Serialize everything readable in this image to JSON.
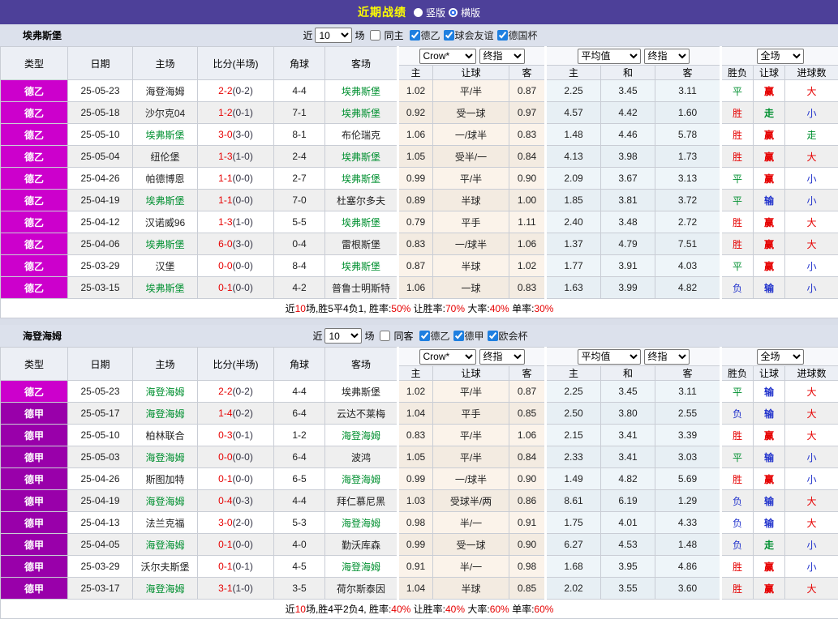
{
  "topbar": {
    "title": "近期战绩",
    "vertical": "竖版",
    "horizontal": "横版"
  },
  "colors": {
    "red": "#E60000",
    "green": "#009030",
    "blue": "#2233CC",
    "team": "#009030",
    "score": "#E60000",
    "half": "#333344",
    "topbar_bg": "#4D4099",
    "title_yellow": "#FFFF00"
  },
  "league_colors": {
    "德乙": "#CC00CC",
    "德甲": "#9900AA"
  },
  "result_colors": {
    "胜": "#E60000",
    "赢": "#E60000",
    "大": "#E60000",
    "平": "#009030",
    "走": "#009030",
    "负": "#2233CC",
    "输": "#2233CC",
    "小": "#2233CC"
  },
  "table_header": {
    "cols": [
      "类型",
      "日期",
      "主场",
      "比分(半场)",
      "角球",
      "客场"
    ],
    "bookmaker": "Crow*",
    "final1": "终指",
    "average": "平均值",
    "final2": "终指",
    "scope": "全场",
    "g1": [
      "主",
      "让球",
      "客"
    ],
    "g2": [
      "主",
      "和",
      "客"
    ],
    "g3": [
      "胜负",
      "让球",
      "进球数"
    ]
  },
  "sections": [
    {
      "team": "埃弗斯堡",
      "filter": {
        "near": "近",
        "count": "10",
        "suffix": "场",
        "same_label": "同主",
        "same_checked": false,
        "leagues": [
          {
            "label": "德乙",
            "checked": true
          },
          {
            "label": "球会友谊",
            "checked": true
          },
          {
            "label": "德国杯",
            "checked": true
          }
        ]
      },
      "rows": [
        {
          "lg": "德乙",
          "date": "25-05-23",
          "home": "海登海姆",
          "hs": false,
          "score": "2-2",
          "half": "(0-2)",
          "cor": "4-4",
          "away": "埃弗斯堡",
          "as": true,
          "o1": "1.02",
          "hc": "平/半",
          "o2": "0.87",
          "a1": "2.25",
          "a2": "3.45",
          "a3": "3.11",
          "r1": "平",
          "r2": "赢",
          "r3": "大"
        },
        {
          "lg": "德乙",
          "date": "25-05-18",
          "home": "沙尔克04",
          "hs": false,
          "score": "1-2",
          "half": "(0-1)",
          "cor": "7-1",
          "away": "埃弗斯堡",
          "as": true,
          "o1": "0.92",
          "hc": "受一球",
          "o2": "0.97",
          "a1": "4.57",
          "a2": "4.42",
          "a3": "1.60",
          "r1": "胜",
          "r2": "走",
          "r3": "小"
        },
        {
          "lg": "德乙",
          "date": "25-05-10",
          "home": "埃弗斯堡",
          "hs": true,
          "score": "3-0",
          "half": "(3-0)",
          "cor": "8-1",
          "away": "布伦瑞克",
          "as": false,
          "o1": "1.06",
          "hc": "一/球半",
          "o2": "0.83",
          "a1": "1.48",
          "a2": "4.46",
          "a3": "5.78",
          "r1": "胜",
          "r2": "赢",
          "r3": "走"
        },
        {
          "lg": "德乙",
          "date": "25-05-04",
          "home": "纽伦堡",
          "hs": false,
          "score": "1-3",
          "half": "(1-0)",
          "cor": "2-4",
          "away": "埃弗斯堡",
          "as": true,
          "o1": "1.05",
          "hc": "受半/一",
          "o2": "0.84",
          "a1": "4.13",
          "a2": "3.98",
          "a3": "1.73",
          "r1": "胜",
          "r2": "赢",
          "r3": "大"
        },
        {
          "lg": "德乙",
          "date": "25-04-26",
          "home": "帕德博恩",
          "hs": false,
          "score": "1-1",
          "half": "(0-0)",
          "cor": "2-7",
          "away": "埃弗斯堡",
          "as": true,
          "o1": "0.99",
          "hc": "平/半",
          "o2": "0.90",
          "a1": "2.09",
          "a2": "3.67",
          "a3": "3.13",
          "r1": "平",
          "r2": "赢",
          "r3": "小"
        },
        {
          "lg": "德乙",
          "date": "25-04-19",
          "home": "埃弗斯堡",
          "hs": true,
          "score": "1-1",
          "half": "(0-0)",
          "cor": "7-0",
          "away": "杜塞尔多夫",
          "as": false,
          "o1": "0.89",
          "hc": "半球",
          "o2": "1.00",
          "a1": "1.85",
          "a2": "3.81",
          "a3": "3.72",
          "r1": "平",
          "r2": "输",
          "r3": "小"
        },
        {
          "lg": "德乙",
          "date": "25-04-12",
          "home": "汉诺威96",
          "hs": false,
          "score": "1-3",
          "half": "(1-0)",
          "cor": "5-5",
          "away": "埃弗斯堡",
          "as": true,
          "o1": "0.79",
          "hc": "平手",
          "o2": "1.11",
          "a1": "2.40",
          "a2": "3.48",
          "a3": "2.72",
          "r1": "胜",
          "r2": "赢",
          "r3": "大"
        },
        {
          "lg": "德乙",
          "date": "25-04-06",
          "home": "埃弗斯堡",
          "hs": true,
          "score": "6-0",
          "half": "(3-0)",
          "cor": "0-4",
          "away": "雷根斯堡",
          "as": false,
          "o1": "0.83",
          "hc": "一/球半",
          "o2": "1.06",
          "a1": "1.37",
          "a2": "4.79",
          "a3": "7.51",
          "r1": "胜",
          "r2": "赢",
          "r3": "大"
        },
        {
          "lg": "德乙",
          "date": "25-03-29",
          "home": "汉堡",
          "hs": false,
          "score": "0-0",
          "half": "(0-0)",
          "cor": "8-4",
          "away": "埃弗斯堡",
          "as": true,
          "o1": "0.87",
          "hc": "半球",
          "o2": "1.02",
          "a1": "1.77",
          "a2": "3.91",
          "a3": "4.03",
          "r1": "平",
          "r2": "赢",
          "r3": "小"
        },
        {
          "lg": "德乙",
          "date": "25-03-15",
          "home": "埃弗斯堡",
          "hs": true,
          "score": "0-1",
          "half": "(0-0)",
          "cor": "4-2",
          "away": "普鲁士明斯特",
          "as": false,
          "o1": "1.06",
          "hc": "一球",
          "o2": "0.83",
          "a1": "1.63",
          "a2": "3.99",
          "a3": "4.82",
          "r1": "负",
          "r2": "输",
          "r3": "小"
        }
      ],
      "summary": [
        {
          "t": "近"
        },
        {
          "t": "10",
          "red": true
        },
        {
          "t": "场,胜5平4负1, 胜率:"
        },
        {
          "t": "50%",
          "red": true
        },
        {
          "t": " 让胜率:"
        },
        {
          "t": "70%",
          "red": true
        },
        {
          "t": " 大率:"
        },
        {
          "t": "40%",
          "red": true
        },
        {
          "t": " 单率:"
        },
        {
          "t": "30%",
          "red": true
        }
      ]
    },
    {
      "team": "海登海姆",
      "filter": {
        "near": "近",
        "count": "10",
        "suffix": "场",
        "same_label": "同客",
        "same_checked": false,
        "leagues": [
          {
            "label": "德乙",
            "checked": true
          },
          {
            "label": "德甲",
            "checked": true
          },
          {
            "label": "欧会杯",
            "checked": true
          }
        ]
      },
      "rows": [
        {
          "lg": "德乙",
          "date": "25-05-23",
          "home": "海登海姆",
          "hs": true,
          "score": "2-2",
          "half": "(0-2)",
          "cor": "4-4",
          "away": "埃弗斯堡",
          "as": false,
          "o1": "1.02",
          "hc": "平/半",
          "o2": "0.87",
          "a1": "2.25",
          "a2": "3.45",
          "a3": "3.11",
          "r1": "平",
          "r2": "输",
          "r3": "大"
        },
        {
          "lg": "德甲",
          "date": "25-05-17",
          "home": "海登海姆",
          "hs": true,
          "score": "1-4",
          "half": "(0-2)",
          "cor": "6-4",
          "away": "云达不莱梅",
          "as": false,
          "o1": "1.04",
          "hc": "平手",
          "o2": "0.85",
          "a1": "2.50",
          "a2": "3.80",
          "a3": "2.55",
          "r1": "负",
          "r2": "输",
          "r3": "大"
        },
        {
          "lg": "德甲",
          "date": "25-05-10",
          "home": "柏林联合",
          "hs": false,
          "score": "0-3",
          "half": "(0-1)",
          "cor": "1-2",
          "away": "海登海姆",
          "as": true,
          "o1": "0.83",
          "hc": "平/半",
          "o2": "1.06",
          "a1": "2.15",
          "a2": "3.41",
          "a3": "3.39",
          "r1": "胜",
          "r2": "赢",
          "r3": "大"
        },
        {
          "lg": "德甲",
          "date": "25-05-03",
          "home": "海登海姆",
          "hs": true,
          "score": "0-0",
          "half": "(0-0)",
          "cor": "6-4",
          "away": "波鸿",
          "as": false,
          "o1": "1.05",
          "hc": "平/半",
          "o2": "0.84",
          "a1": "2.33",
          "a2": "3.41",
          "a3": "3.03",
          "r1": "平",
          "r2": "输",
          "r3": "小"
        },
        {
          "lg": "德甲",
          "date": "25-04-26",
          "home": "斯图加特",
          "hs": false,
          "score": "0-1",
          "half": "(0-0)",
          "cor": "6-5",
          "away": "海登海姆",
          "as": true,
          "o1": "0.99",
          "hc": "一/球半",
          "o2": "0.90",
          "a1": "1.49",
          "a2": "4.82",
          "a3": "5.69",
          "r1": "胜",
          "r2": "赢",
          "r3": "小"
        },
        {
          "lg": "德甲",
          "date": "25-04-19",
          "home": "海登海姆",
          "hs": true,
          "score": "0-4",
          "half": "(0-3)",
          "cor": "4-4",
          "away": "拜仁慕尼黑",
          "as": false,
          "o1": "1.03",
          "hc": "受球半/两",
          "o2": "0.86",
          "a1": "8.61",
          "a2": "6.19",
          "a3": "1.29",
          "r1": "负",
          "r2": "输",
          "r3": "大"
        },
        {
          "lg": "德甲",
          "date": "25-04-13",
          "home": "法兰克福",
          "hs": false,
          "score": "3-0",
          "half": "(2-0)",
          "cor": "5-3",
          "away": "海登海姆",
          "as": true,
          "o1": "0.98",
          "hc": "半/一",
          "o2": "0.91",
          "a1": "1.75",
          "a2": "4.01",
          "a3": "4.33",
          "r1": "负",
          "r2": "输",
          "r3": "大"
        },
        {
          "lg": "德甲",
          "date": "25-04-05",
          "home": "海登海姆",
          "hs": true,
          "score": "0-1",
          "half": "(0-0)",
          "cor": "4-0",
          "away": "勤沃库森",
          "as": false,
          "o1": "0.99",
          "hc": "受一球",
          "o2": "0.90",
          "a1": "6.27",
          "a2": "4.53",
          "a3": "1.48",
          "r1": "负",
          "r2": "走",
          "r3": "小"
        },
        {
          "lg": "德甲",
          "date": "25-03-29",
          "home": "沃尔夫斯堡",
          "hs": false,
          "score": "0-1",
          "half": "(0-1)",
          "cor": "4-5",
          "away": "海登海姆",
          "as": true,
          "o1": "0.91",
          "hc": "半/一",
          "o2": "0.98",
          "a1": "1.68",
          "a2": "3.95",
          "a3": "4.86",
          "r1": "胜",
          "r2": "赢",
          "r3": "小"
        },
        {
          "lg": "德甲",
          "date": "25-03-17",
          "home": "海登海姆",
          "hs": true,
          "score": "3-1",
          "half": "(1-0)",
          "cor": "3-5",
          "away": "荷尔斯泰因",
          "as": false,
          "o1": "1.04",
          "hc": "半球",
          "o2": "0.85",
          "a1": "2.02",
          "a2": "3.55",
          "a3": "3.60",
          "r1": "胜",
          "r2": "赢",
          "r3": "大"
        }
      ],
      "summary": [
        {
          "t": "近"
        },
        {
          "t": "10",
          "red": true
        },
        {
          "t": "场,胜4平2负4, 胜率:"
        },
        {
          "t": "40%",
          "red": true
        },
        {
          "t": " 让胜率:"
        },
        {
          "t": "40%",
          "red": true
        },
        {
          "t": " 大率:"
        },
        {
          "t": "60%",
          "red": true
        },
        {
          "t": " 单率:"
        },
        {
          "t": "60%",
          "red": true
        }
      ]
    }
  ]
}
